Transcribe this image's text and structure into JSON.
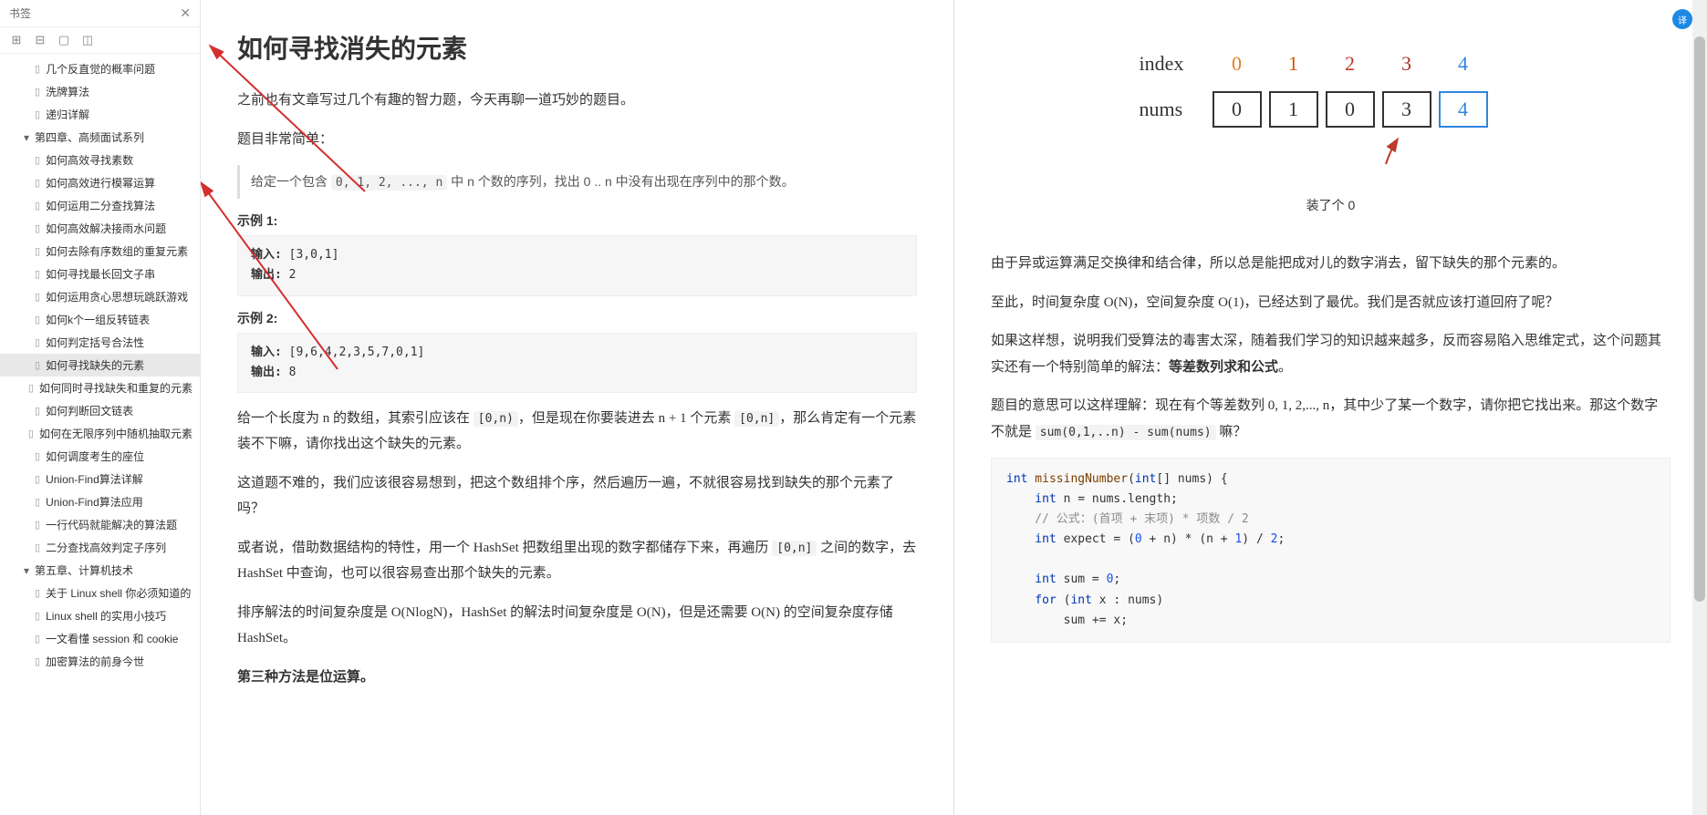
{
  "sidebar": {
    "title": "书签",
    "items": [
      {
        "label": "几个反直觉的概率问题",
        "level": 2
      },
      {
        "label": "洗牌算法",
        "level": 2
      },
      {
        "label": "递归详解",
        "level": 2
      },
      {
        "label": "第四章、高频面试系列",
        "level": 1,
        "chapter": true
      },
      {
        "label": "如何高效寻找素数",
        "level": 2
      },
      {
        "label": "如何高效进行模幂运算",
        "level": 2
      },
      {
        "label": "如何运用二分查找算法",
        "level": 2
      },
      {
        "label": "如何高效解决接雨水问题",
        "level": 2
      },
      {
        "label": "如何去除有序数组的重复元素",
        "level": 2
      },
      {
        "label": "如何寻找最长回文子串",
        "level": 2
      },
      {
        "label": "如何运用贪心思想玩跳跃游戏",
        "level": 2
      },
      {
        "label": "如何k个一组反转链表",
        "level": 2
      },
      {
        "label": "如何判定括号合法性",
        "level": 2
      },
      {
        "label": "如何寻找缺失的元素",
        "level": 2,
        "active": true
      },
      {
        "label": "如何同时寻找缺失和重复的元素",
        "level": 2
      },
      {
        "label": "如何判断回文链表",
        "level": 2
      },
      {
        "label": "如何在无限序列中随机抽取元素",
        "level": 2
      },
      {
        "label": "如何调度考生的座位",
        "level": 2
      },
      {
        "label": "Union-Find算法详解",
        "level": 2
      },
      {
        "label": "Union-Find算法应用",
        "level": 2
      },
      {
        "label": "一行代码就能解决的算法题",
        "level": 2
      },
      {
        "label": "二分查找高效判定子序列",
        "level": 2
      },
      {
        "label": "第五章、计算机技术",
        "level": 1,
        "chapter": true
      },
      {
        "label": "关于 Linux shell 你必须知道的",
        "level": 2
      },
      {
        "label": "Linux shell 的实用小技巧",
        "level": 2
      },
      {
        "label": "一文看懂 session 和 cookie",
        "level": 2
      },
      {
        "label": "加密算法的前身今世",
        "level": 2
      }
    ]
  },
  "left": {
    "title": "如何寻找消失的元素",
    "p1": "之前也有文章写过几个有趣的智力题，今天再聊一道巧妙的题目。",
    "p2": "题目非常简单：",
    "quote_a": "给定一个包含 ",
    "quote_code": "0, 1, 2, ..., n",
    "quote_b": " 中 n 个数的序列，找出 0 .. n 中没有出现在序列中的那个数。",
    "ex1_label": "示例 1:",
    "ex1_in_label": "输入:",
    "ex1_in": " [3,0,1]",
    "ex1_out_label": "输出:",
    "ex1_out": " 2",
    "ex2_label": "示例 2:",
    "ex2_in_label": "输入:",
    "ex2_in": " [9,6,4,2,3,5,7,0,1]",
    "ex2_out_label": "输出:",
    "ex2_out": " 8",
    "p3a": "给一个长度为 n 的数组，其索引应该在 ",
    "p3c1": "[0,n)",
    "p3b": "，但是现在你要装进去 n + 1 个元素 ",
    "p3c2": "[0,n]",
    "p3c": "，那么肯定有一个元素装不下嘛，请你找出这个缺失的元素。",
    "p4": "这道题不难的，我们应该很容易想到，把这个数组排个序，然后遍历一遍，不就很容易找到缺失的那个元素了吗？",
    "p5a": "或者说，借助数据结构的特性，用一个 HashSet 把数组里出现的数字都储存下来，再遍历 ",
    "p5c": "[0,n]",
    "p5b": " 之间的数字，去 HashSet 中查询，也可以很容易查出那个缺失的元素。",
    "p6": "排序解法的时间复杂度是 O(NlogN)，HashSet 的解法时间复杂度是 O(N)，但是还需要 O(N) 的空间复杂度存储 HashSet。",
    "p7": "第三种方法是位运算。"
  },
  "right": {
    "diag": {
      "index_label": "index",
      "nums_label": "nums",
      "indices": [
        "0",
        "1",
        "2",
        "3",
        "4"
      ],
      "nums": [
        "0",
        "1",
        "0",
        "3",
        "4"
      ],
      "caption": "装了个 0"
    },
    "p1": "由于异或运算满足交换律和结合律，所以总是能把成对儿的数字消去，留下缺失的那个元素的。",
    "p2": "至此，时间复杂度 O(N)，空间复杂度 O(1)，已经达到了最优。我们是否就应该打道回府了呢？",
    "p3a": "如果这样想，说明我们受算法的毒害太深，随着我们学习的知识越来越多，反而容易陷入思维定式，这个问题其实还有一个特别简单的解法：",
    "p3b": "等差数列求和公式",
    "p3c": "。",
    "p4a": "题目的意思可以这样理解：现在有个等差数列 0, 1, 2,..., n，其中少了某一个数字，请你把它找出来。那这个数字不就是 ",
    "p4code": "sum(0,1,..n) - sum(nums)",
    "p4b": " 嘛？",
    "code": {
      "l1a": "int",
      "l1b": " missingNumber",
      "l1c": "(",
      "l1d": "int",
      "l1e": "[] nums) {",
      "l2a": "    int",
      "l2b": " n = nums.length;",
      "l3": "    // 公式：(首项 + 末项) * 项数 / 2",
      "l4a": "    int",
      "l4b": " expect = (",
      "l4c": "0",
      "l4d": " + n) * (n + ",
      "l4e": "1",
      "l4f": ") / ",
      "l4g": "2",
      "l4h": ";",
      "l5": " ",
      "l6a": "    int",
      "l6b": " sum = ",
      "l6c": "0",
      "l6d": ";",
      "l7a": "    for",
      "l7b": " (",
      "l7c": "int",
      "l7d": " x : nums)",
      "l8": "        sum += x;"
    }
  },
  "badge": "译"
}
